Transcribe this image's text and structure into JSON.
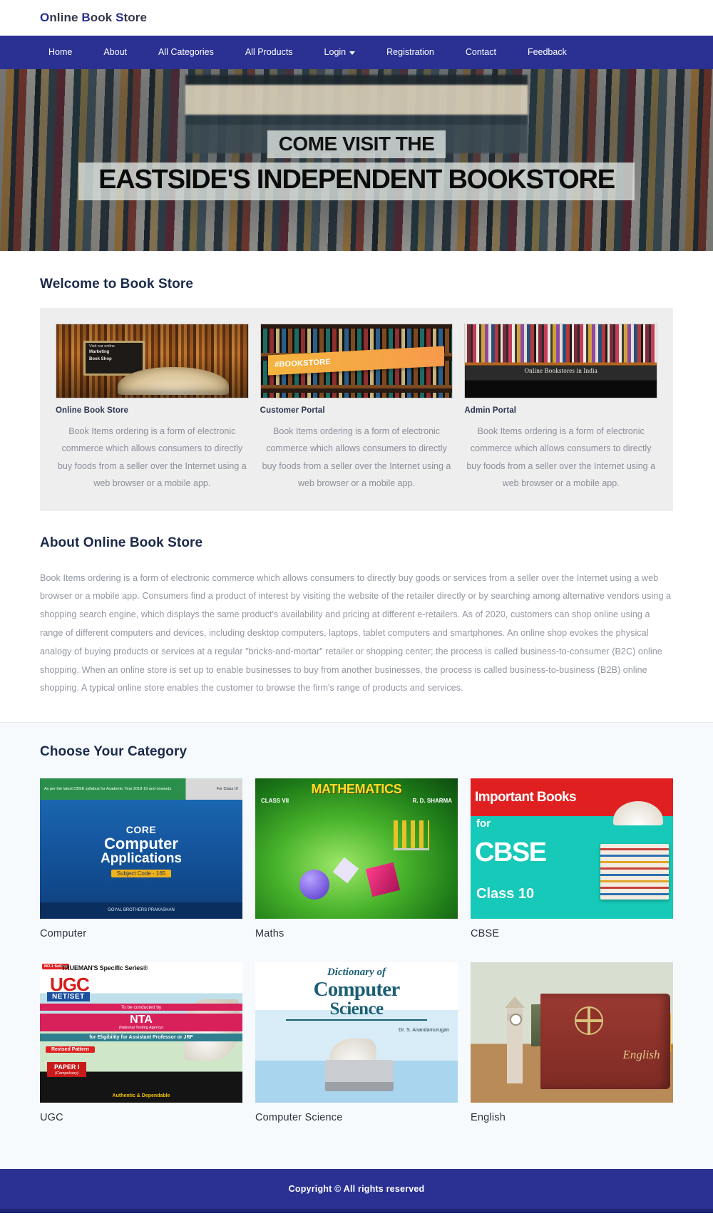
{
  "site": {
    "logo_plain": "nline",
    "logo_full": "Online Book Store",
    "logo_parts": [
      {
        "cap": "O",
        "rest": "nline "
      },
      {
        "cap": "B",
        "rest": "ook "
      },
      {
        "cap": "S",
        "rest": "tore"
      }
    ],
    "brand_color": "#2a3193"
  },
  "nav": {
    "items": [
      {
        "label": "Home",
        "has_caret": false
      },
      {
        "label": "About",
        "has_caret": false
      },
      {
        "label": "All Categories",
        "has_caret": false
      },
      {
        "label": "All Products",
        "has_caret": false
      },
      {
        "label": "Login",
        "has_caret": true
      },
      {
        "label": "Registration",
        "has_caret": false
      },
      {
        "label": "Contact",
        "has_caret": false
      },
      {
        "label": "Feedback",
        "has_caret": false
      }
    ]
  },
  "hero": {
    "line1": "COME VISIT THE",
    "line2": "EASTSIDE'S INDEPENDENT BOOKSTORE"
  },
  "welcome": {
    "title": "Welcome to Book Store",
    "cards": [
      {
        "title": "Online Book Store",
        "text": "Book Items ordering is a form of electronic commerce which allows consumers to directly buy foods from a seller over the Internet using a web browser or a mobile app.",
        "image_caption_line1": "Visit our online",
        "image_caption_line2": "Marketing",
        "image_caption_line3": "Book Shop"
      },
      {
        "title": "Customer Portal",
        "text": "Book Items ordering is a form of electronic commerce which allows consumers to directly buy foods from a seller over the Internet using a web browser or a mobile app.",
        "image_banner": "#BOOKSTORE"
      },
      {
        "title": "Admin Portal",
        "text": "Book Items ordering is a form of electronic commerce which allows consumers to directly buy foods from a seller over the Internet using a web browser or a mobile app.",
        "image_caption": "Online Bookstores in India"
      }
    ]
  },
  "about": {
    "title": "About Online Book Store",
    "text": "Book Items ordering is a form of electronic commerce which allows consumers to directly buy goods or services from a seller over the Internet using a web browser or a mobile app. Consumers find a product of interest by visiting the website of the retailer directly or by searching among alternative vendors using a shopping search engine, which displays the same product's availability and pricing at different e-retailers. As of 2020, customers can shop online using a range of different computers and devices, including desktop computers, laptops, tablet computers and smartphones. An online shop evokes the physical analogy of buying products or services at a regular \"bricks-and-mortar\" retailer or shopping center; the process is called business-to-consumer (B2C) online shopping. When an online store is set up to enable businesses to buy from another businesses, the process is called business-to-business (B2B) online shopping. A typical online store enables the customer to browse the firm's range of products and services."
  },
  "category": {
    "title": "Choose Your Category",
    "items": [
      {
        "label": "Computer",
        "cover": {
          "badge_left": "As per the latest CBSE syllabus for Academic Year 2018-19 and onwards",
          "badge_right": "For Class IX",
          "line1": "CORE",
          "line2": "Computer",
          "line3": "Applications",
          "line4": "Subject Code - 165",
          "publisher": "GOYAL BROTHERS PRAKASHAN"
        }
      },
      {
        "label": "Maths",
        "cover": {
          "title": "MATHEMATICS",
          "class": "CLASS VII",
          "author": "R. D. SHARMA"
        }
      },
      {
        "label": "CBSE",
        "cover": {
          "line1": "Important Books",
          "line2": "for",
          "line3": "CBSE",
          "line4": "Class 10"
        }
      },
      {
        "label": "UGC",
        "cover": {
          "badge": "NO.1 Selling",
          "series": "TRUEMAN'S Specific Series®",
          "title": "UGC",
          "subtitle": "NET/SET",
          "conducted": "To be conducted by",
          "agency": "NTA",
          "agency_full": "(National Testing Agency)",
          "eligibility": "for Eligibility for Assistant Professor or JRF",
          "revised": "Revised Pattern",
          "paper": "PAPER I",
          "paper_note": "(Compulsory)",
          "bottom": "Authentic & Dependable"
        }
      },
      {
        "label": "Computer Science",
        "cover": {
          "line1": "Dictionary of",
          "line2": "Computer",
          "line3": "Science",
          "author": "Dr. S. Anandamurugan"
        }
      },
      {
        "label": "English",
        "cover": {
          "book_title": "English"
        }
      }
    ]
  },
  "footer": {
    "copyright": "Copyright © All rights reserved"
  }
}
